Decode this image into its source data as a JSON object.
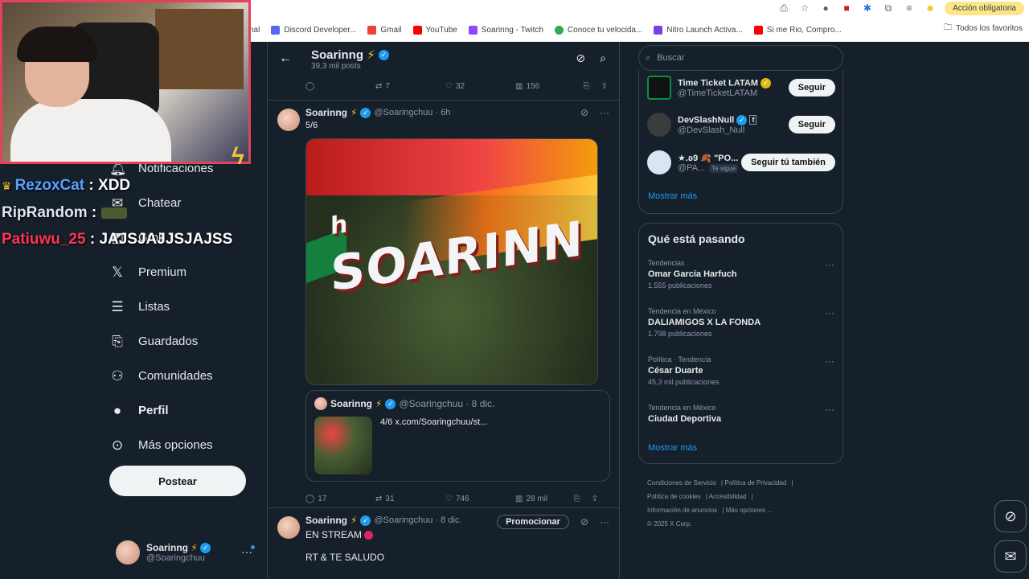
{
  "browser": {
    "accion_label": "Acción obligatoria",
    "bookmarks": [
      {
        "label": "nal",
        "color": "#9aa0a6"
      },
      {
        "label": "Discord Developer...",
        "color": "#5865f2"
      },
      {
        "label": "Gmail",
        "color": "#ea4335"
      },
      {
        "label": "YouTube",
        "color": "#ff0000"
      },
      {
        "label": "Soarinng - Twitch",
        "color": "#9146ff"
      },
      {
        "label": "Conoce tu velocida...",
        "color": "#34a853"
      },
      {
        "label": "Nitro Launch Activa...",
        "color": "#7b3fe4"
      },
      {
        "label": "Si me Rio, Compro...",
        "color": "#ff0000"
      }
    ],
    "all_favorites": "Todos los favoritos"
  },
  "chat": [
    {
      "user": "RezoxCat",
      "message": "XDD"
    },
    {
      "user": "RipRandom",
      "message": ""
    },
    {
      "user": "Patiuwu_25",
      "message": "JAJSJAJJSJAJSS"
    }
  ],
  "nav": {
    "items": [
      "Notificaciones",
      "Chatear",
      "Grok",
      "Premium",
      "Listas",
      "Guardados",
      "Comunidades",
      "Perfil",
      "Más opciones"
    ],
    "post_label": "Postear",
    "profile_name": "Soarinng",
    "profile_handle": "@Soaringchuu"
  },
  "header": {
    "title": "Soarinng",
    "subtitle": "39,3 mil posts"
  },
  "top_actions": {
    "reposts": "7",
    "likes": "32",
    "views": "156"
  },
  "tweet1": {
    "name": "Soarinng",
    "handle": "@Soaringchuu · 6h",
    "text": "5/6",
    "media_text": "SOARINN",
    "media_prefix": "h",
    "quote": {
      "name": "Soarinng",
      "handle": "@Soaringchuu · 8 dic.",
      "text": "4/6  x.com/Soaringchuu/st..."
    },
    "replies": "17",
    "reposts": "31",
    "likes": "746",
    "views": "28 mil"
  },
  "tweet2": {
    "name": "Soarinng",
    "handle": "@Soaringchuu · 8 dic.",
    "promo_label": "Promocionar",
    "line1": "EN STREAM",
    "line2": "RT & TE SALUDO"
  },
  "search": {
    "placeholder": "Buscar"
  },
  "who_to_follow": [
    {
      "name": "Time Ticket LATAM",
      "handle": "@TimeTicketLATAM",
      "button": "Seguir",
      "color": "#111111"
    },
    {
      "name": "DevSlashNull",
      "handle": "@DevSlash_Null",
      "button": "Seguir",
      "color": "#3b3b3b"
    },
    {
      "name": "★.ʚ9 🍂 \"PO...",
      "handle": "@PA...",
      "button": "Seguir tú también",
      "tag": "Te sigue",
      "color": "#d9e4f5"
    }
  ],
  "show_more": "Mostrar más",
  "trends": {
    "title": "Qué está pasando",
    "items": [
      {
        "category": "Tendencias",
        "topic": "Omar García Harfuch",
        "count": "1.555 publicaciones"
      },
      {
        "category": "Tendencia en México",
        "topic": "DALIAMIGOS X LA FONDA",
        "count": "1.798 publicaciones"
      },
      {
        "category": "Política · Tendencia",
        "topic": "César Duarte",
        "count": "45,3 mil publicaciones"
      },
      {
        "category": "Tendencia en México",
        "topic": "Ciudad Deportiva",
        "count": ""
      }
    ],
    "show_more": "Mostrar más"
  },
  "footer": {
    "links": [
      "Condiciones de Servicio",
      "Política de Privacidad",
      "Política de cookies",
      "Accesibilidad",
      "Información de anuncios",
      "Más opciones ..."
    ],
    "copyright": "© 2025 X Corp."
  }
}
